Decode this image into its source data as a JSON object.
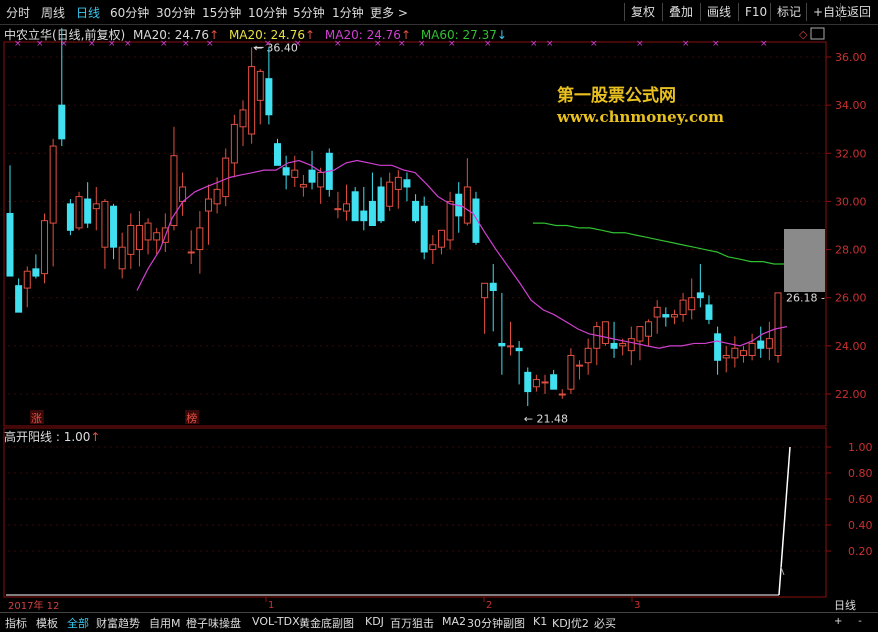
{
  "topbar": {
    "periods": [
      {
        "label": "分时",
        "active": false
      },
      {
        "label": "周线",
        "active": false
      },
      {
        "label": "日线",
        "active": true
      },
      {
        "label": "60分钟",
        "active": false
      },
      {
        "label": "30分钟",
        "active": false
      },
      {
        "label": "15分钟",
        "active": false
      },
      {
        "label": "10分钟",
        "active": false
      },
      {
        "label": "5分钟",
        "active": false
      },
      {
        "label": "1分钟",
        "active": false
      },
      {
        "label": "更多 >",
        "active": false
      }
    ],
    "right_buttons": [
      "复权",
      "叠加",
      "画线",
      "F10",
      "标记",
      "+自选",
      "返回"
    ]
  },
  "header": {
    "title": "中农立华(日线,前复权)",
    "ma_labels": [
      {
        "text": "MA20: 24.76",
        "color": "#d8d8d8"
      },
      {
        "text": "MA20: 24.76",
        "color": "#e8e040"
      },
      {
        "text": "MA20: 24.76",
        "color": "#d040d0"
      },
      {
        "text": "MA60: 27.37",
        "color": "#30c030"
      }
    ]
  },
  "watermark": {
    "line1": "第一股票公式网",
    "line2": "www.chnmoney.com"
  },
  "chart_data": [
    {
      "type": "candlestick",
      "title": "中农立华(日线,前复权)",
      "ylim": [
        21,
        37
      ],
      "yticks": [
        "22.00",
        "24.00",
        "26.00",
        "28.00",
        "30.00",
        "32.00",
        "34.00",
        "36.00"
      ],
      "colors": {
        "up": "#e05040",
        "down": "#40e0f0",
        "ma20": "#d040d0",
        "ma60": "#30c030"
      },
      "candles": [
        [
          29.5,
          31.5,
          27.5,
          26.9
        ],
        [
          26.5,
          26.8,
          25.4,
          25.4
        ],
        [
          26.4,
          27.3,
          25.6,
          27.1
        ],
        [
          27.2,
          27.8,
          26.8,
          26.9
        ],
        [
          27.0,
          29.5,
          26.6,
          29.2
        ],
        [
          29.1,
          32.6,
          27.3,
          32.3
        ],
        [
          34.0,
          37.2,
          32.3,
          32.6
        ],
        [
          29.9,
          30.1,
          28.6,
          28.8
        ],
        [
          28.9,
          30.4,
          28.8,
          30.2
        ],
        [
          30.1,
          30.8,
          28.9,
          29.1
        ],
        [
          29.7,
          30.6,
          28.8,
          29.9
        ],
        [
          28.1,
          30.1,
          27.2,
          30.0
        ],
        [
          29.8,
          29.9,
          27.6,
          28.1
        ],
        [
          27.2,
          28.7,
          26.8,
          28.1
        ],
        [
          27.8,
          29.5,
          27.2,
          29.0
        ],
        [
          28.0,
          29.6,
          27.3,
          29.0
        ],
        [
          28.4,
          29.3,
          27.8,
          29.1
        ],
        [
          28.4,
          28.9,
          27.8,
          28.7
        ],
        [
          28.3,
          29.5,
          27.9,
          28.9
        ],
        [
          29.0,
          33.1,
          28.8,
          31.9
        ],
        [
          30.0,
          31.2,
          29.4,
          30.6
        ],
        [
          27.9,
          28.8,
          27.4,
          27.9
        ],
        [
          28.0,
          29.6,
          27.0,
          28.9
        ],
        [
          29.6,
          30.7,
          28.2,
          30.1
        ],
        [
          29.9,
          31.0,
          29.5,
          30.5
        ],
        [
          30.2,
          32.2,
          29.8,
          31.8
        ],
        [
          31.6,
          33.6,
          31.0,
          33.2
        ],
        [
          33.1,
          34.2,
          32.3,
          33.8
        ],
        [
          32.8,
          36.4,
          32.4,
          35.6
        ],
        [
          34.2,
          35.5,
          33.2,
          35.4
        ],
        [
          35.1,
          36.4,
          33.2,
          33.6
        ],
        [
          32.4,
          32.6,
          31.5,
          31.5
        ],
        [
          31.4,
          31.9,
          30.5,
          31.1
        ],
        [
          31.0,
          31.9,
          30.6,
          31.3
        ],
        [
          30.6,
          31.1,
          30.2,
          30.7
        ],
        [
          31.3,
          32.1,
          30.5,
          30.8
        ],
        [
          30.6,
          31.4,
          29.9,
          31.2
        ],
        [
          32.0,
          32.2,
          30.2,
          30.5
        ],
        [
          29.7,
          30.4,
          29.3,
          29.7
        ],
        [
          29.6,
          30.7,
          29.2,
          29.9
        ],
        [
          30.4,
          30.6,
          29.2,
          29.2
        ],
        [
          29.6,
          30.6,
          28.8,
          29.2
        ],
        [
          30.0,
          31.2,
          29.0,
          29.0
        ],
        [
          30.6,
          31.0,
          29.1,
          29.2
        ],
        [
          29.8,
          31.2,
          29.6,
          30.8
        ],
        [
          30.5,
          31.3,
          29.7,
          31.0
        ],
        [
          30.9,
          31.2,
          30.0,
          30.6
        ],
        [
          30.0,
          30.3,
          29.1,
          29.2
        ],
        [
          29.8,
          30.2,
          27.6,
          27.9
        ],
        [
          28.0,
          28.6,
          27.4,
          28.2
        ],
        [
          28.1,
          28.8,
          27.8,
          28.8
        ],
        [
          28.4,
          30.4,
          28.0,
          30.0
        ],
        [
          30.3,
          30.8,
          28.7,
          29.4
        ],
        [
          29.1,
          31.8,
          29.0,
          30.6
        ],
        [
          30.1,
          30.4,
          28.2,
          28.3
        ],
        [
          26.0,
          26.6,
          24.5,
          26.6
        ],
        [
          26.6,
          27.4,
          24.6,
          26.3
        ],
        [
          24.1,
          26.2,
          22.8,
          24.0
        ],
        [
          24.0,
          25.0,
          23.6,
          24.0
        ],
        [
          23.9,
          24.2,
          22.4,
          23.8
        ],
        [
          22.9,
          23.1,
          21.5,
          22.1
        ],
        [
          22.3,
          22.8,
          22.1,
          22.6
        ],
        [
          22.5,
          22.8,
          22.0,
          22.5
        ],
        [
          22.8,
          23.0,
          22.2,
          22.2
        ],
        [
          22.0,
          22.2,
          21.8,
          22.0
        ],
        [
          22.2,
          23.9,
          22.0,
          23.6
        ],
        [
          23.2,
          23.4,
          22.6,
          23.2
        ],
        [
          23.3,
          24.3,
          22.8,
          23.9
        ],
        [
          23.9,
          25.0,
          23.2,
          24.8
        ],
        [
          24.1,
          25.0,
          24.0,
          25.0
        ],
        [
          24.1,
          25.0,
          23.5,
          23.9
        ],
        [
          24.0,
          24.3,
          23.6,
          24.1
        ],
        [
          23.8,
          24.8,
          23.2,
          24.3
        ],
        [
          24.2,
          24.8,
          23.4,
          24.8
        ],
        [
          24.4,
          25.1,
          24.0,
          25.0
        ],
        [
          25.2,
          25.9,
          24.5,
          25.6
        ],
        [
          25.3,
          25.6,
          24.8,
          25.2
        ],
        [
          25.2,
          25.5,
          24.9,
          25.3
        ],
        [
          25.3,
          26.2,
          25.0,
          25.9
        ],
        [
          25.5,
          26.8,
          25.1,
          26.0
        ],
        [
          26.2,
          27.4,
          25.6,
          26.0
        ],
        [
          25.7,
          26.1,
          24.9,
          25.1
        ],
        [
          24.5,
          24.8,
          22.8,
          23.4
        ],
        [
          23.5,
          24.0,
          22.9,
          23.6
        ],
        [
          23.5,
          24.4,
          23.1,
          23.9
        ],
        [
          23.6,
          24.0,
          23.3,
          23.8
        ],
        [
          23.6,
          24.5,
          23.4,
          24.1
        ],
        [
          24.2,
          24.8,
          23.5,
          23.9
        ],
        [
          23.9,
          25.0,
          23.4,
          24.3
        ],
        [
          23.6,
          26.2,
          23.3,
          26.2
        ]
      ],
      "ma20": [
        [
          26.3,
          137
        ],
        [
          27.2,
          148
        ],
        [
          28.0,
          160
        ],
        [
          29.3,
          172
        ],
        [
          30.0,
          183
        ],
        [
          30.4,
          195
        ],
        [
          30.6,
          206
        ],
        [
          30.8,
          218
        ],
        [
          31.0,
          230
        ],
        [
          31.1,
          241
        ],
        [
          31.2,
          253
        ],
        [
          31.3,
          264
        ],
        [
          31.3,
          276
        ],
        [
          31.6,
          288
        ],
        [
          31.7,
          299
        ],
        [
          31.5,
          311
        ],
        [
          31.2,
          322
        ],
        [
          31.3,
          334
        ],
        [
          31.6,
          346
        ],
        [
          31.7,
          357
        ],
        [
          31.6,
          369
        ],
        [
          31.5,
          380
        ],
        [
          31.5,
          392
        ],
        [
          31.3,
          404
        ],
        [
          31.2,
          415
        ],
        [
          30.7,
          427
        ],
        [
          30.2,
          438
        ],
        [
          29.9,
          450
        ],
        [
          29.8,
          462
        ],
        [
          29.5,
          473
        ],
        [
          28.7,
          485
        ],
        [
          28.0,
          496
        ],
        [
          27.3,
          508
        ],
        [
          26.6,
          520
        ],
        [
          25.9,
          531
        ],
        [
          25.5,
          543
        ],
        [
          25.3,
          554
        ],
        [
          25.0,
          566
        ],
        [
          24.7,
          578
        ],
        [
          24.5,
          589
        ],
        [
          24.4,
          601
        ],
        [
          24.3,
          612
        ],
        [
          24.2,
          624
        ],
        [
          24.1,
          636
        ],
        [
          24.0,
          647
        ],
        [
          23.9,
          659
        ],
        [
          24.0,
          670
        ],
        [
          24.0,
          682
        ],
        [
          24.1,
          694
        ],
        [
          24.1,
          705
        ],
        [
          24.2,
          717
        ],
        [
          24.1,
          728
        ],
        [
          24.0,
          740
        ],
        [
          24.2,
          752
        ],
        [
          24.5,
          763
        ],
        [
          24.7,
          775
        ],
        [
          24.8,
          787
        ]
      ],
      "ma60": [
        [
          29.1,
          533
        ],
        [
          29.1,
          544
        ],
        [
          29.0,
          556
        ],
        [
          29.0,
          567
        ],
        [
          28.9,
          579
        ],
        [
          28.9,
          590
        ],
        [
          28.8,
          602
        ],
        [
          28.7,
          613
        ],
        [
          28.7,
          625
        ],
        [
          28.6,
          636
        ],
        [
          28.5,
          648
        ],
        [
          28.4,
          659
        ],
        [
          28.3,
          671
        ],
        [
          28.2,
          682
        ],
        [
          28.1,
          694
        ],
        [
          28.0,
          705
        ],
        [
          27.9,
          717
        ],
        [
          27.7,
          728
        ],
        [
          27.6,
          740
        ],
        [
          27.5,
          751
        ],
        [
          27.5,
          763
        ],
        [
          27.4,
          774
        ],
        [
          27.4,
          787
        ]
      ],
      "high_label": "36.40",
      "low_label": "21.48",
      "last_label": "26.18",
      "markers": [
        {
          "label": "涨",
          "candle": 3,
          "color": "#e05040"
        },
        {
          "label": "榜",
          "candle": 21,
          "color": "#e05040"
        }
      ]
    },
    {
      "type": "line",
      "title": "高开阳线",
      "value_label": "1.00",
      "ylim": [
        0,
        1.05
      ],
      "yticks": [
        "0.20",
        "0.40",
        "0.60",
        "0.80",
        "1.00"
      ],
      "color": "#ffffff",
      "last_value": 1.0
    }
  ],
  "x_axis": {
    "date_label": "2017年 12",
    "months": [
      "1",
      "2",
      "3"
    ]
  },
  "period_label": "日线",
  "bottom_tabs": [
    {
      "label": "指标",
      "active": false
    },
    {
      "label": "模板",
      "active": false
    },
    {
      "label": "全部",
      "active": true
    },
    {
      "label": "财富趋势",
      "active": false
    },
    {
      "label": "自用M",
      "active": false
    },
    {
      "label": "橙子味操盘",
      "active": false
    },
    {
      "label": "VOL-TDX",
      "active": false
    },
    {
      "label": "黄金底副图",
      "active": false
    },
    {
      "label": "KDJ",
      "active": false
    },
    {
      "label": "百万狙击",
      "active": false
    },
    {
      "label": "MA2",
      "active": false
    },
    {
      "label": "30分钟副图",
      "active": false
    },
    {
      "label": "K1",
      "active": false
    },
    {
      "label": "KDJ优2",
      "active": false
    },
    {
      "label": "必买",
      "active": false
    }
  ],
  "scroll_nav": [
    "+",
    "-",
    "0"
  ]
}
